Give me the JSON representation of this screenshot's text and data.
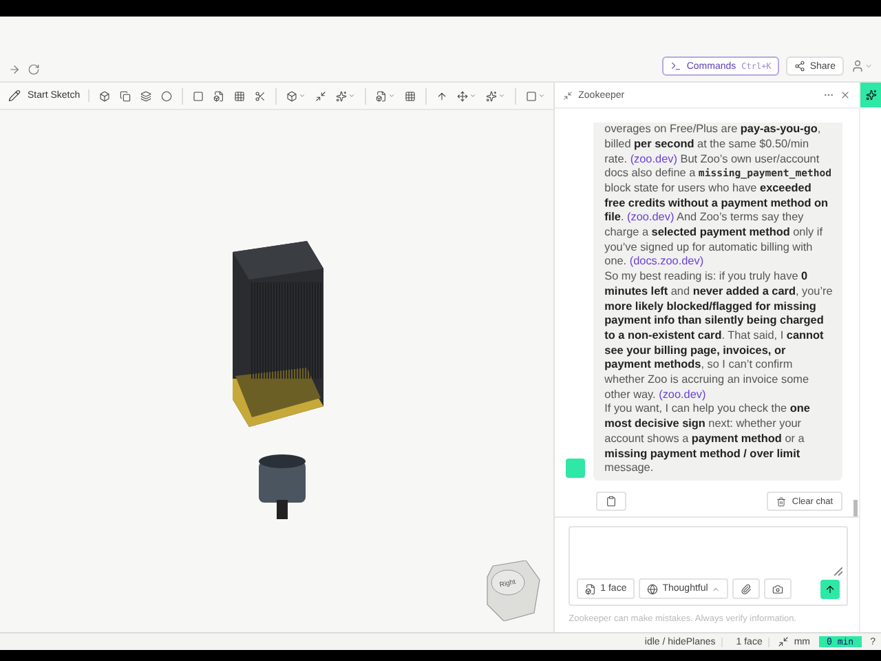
{
  "topbar": {
    "commands": {
      "label": "Commands",
      "shortcut": "Ctrl+K"
    },
    "share": "Share"
  },
  "toolbar": {
    "start_sketch": "Start Sketch"
  },
  "nav_cube": {
    "label": "Right"
  },
  "panel": {
    "title": "Zookeeper",
    "message": [
      [
        {
          "kind": "text",
          "text": "overages on Free/Plus are **pay-as-you-go**, billed **per second** at the same $0.50/min rate."
        },
        {
          "kind": "link",
          "text": "(zoo.dev)"
        },
        {
          "kind": "text",
          "text": "But Zoo’s own user/account docs also define a"
        },
        {
          "kind": "code",
          "text": "missing_payment_method"
        },
        {
          "kind": "text",
          "text": "block state for users who have **exceeded free credits without a payment method on file**."
        },
        {
          "kind": "link",
          "text": "(zoo.dev)"
        },
        {
          "kind": "text",
          "text": "And Zoo’s terms say they charge a **selected payment method** only if you’ve signed up for automatic billing with one."
        },
        {
          "kind": "link",
          "text": "(docs.zoo.dev)"
        }
      ],
      [
        {
          "kind": "text",
          "text": "So my best reading is: if you truly have **0 minutes left** and **never added a card**, you’re **more likely blocked/flagged for missing payment info than silently being charged to a non-existent card**. That said, I **cannot see your billing page, invoices, or payment methods**, so I can’t confirm whether Zoo is accruing an invoice some other way."
        },
        {
          "kind": "link",
          "text": "(zoo.dev)"
        }
      ],
      [
        {
          "kind": "text",
          "text": "If you want, I can help you check the **one most decisive sign** next: whether your account shows a **payment method** or a **missing payment method / over limit** message."
        }
      ]
    ],
    "clear_chat": "Clear chat",
    "composer": {
      "context": "1 face",
      "mode": "Thoughtful"
    },
    "disclaimer": "Zookeeper can make mistakes. Always verify information."
  },
  "status_bar": {
    "state": "idle / hidePlanes",
    "selection": "1 face",
    "units": "mm",
    "credits": "0 min",
    "help": "?"
  }
}
